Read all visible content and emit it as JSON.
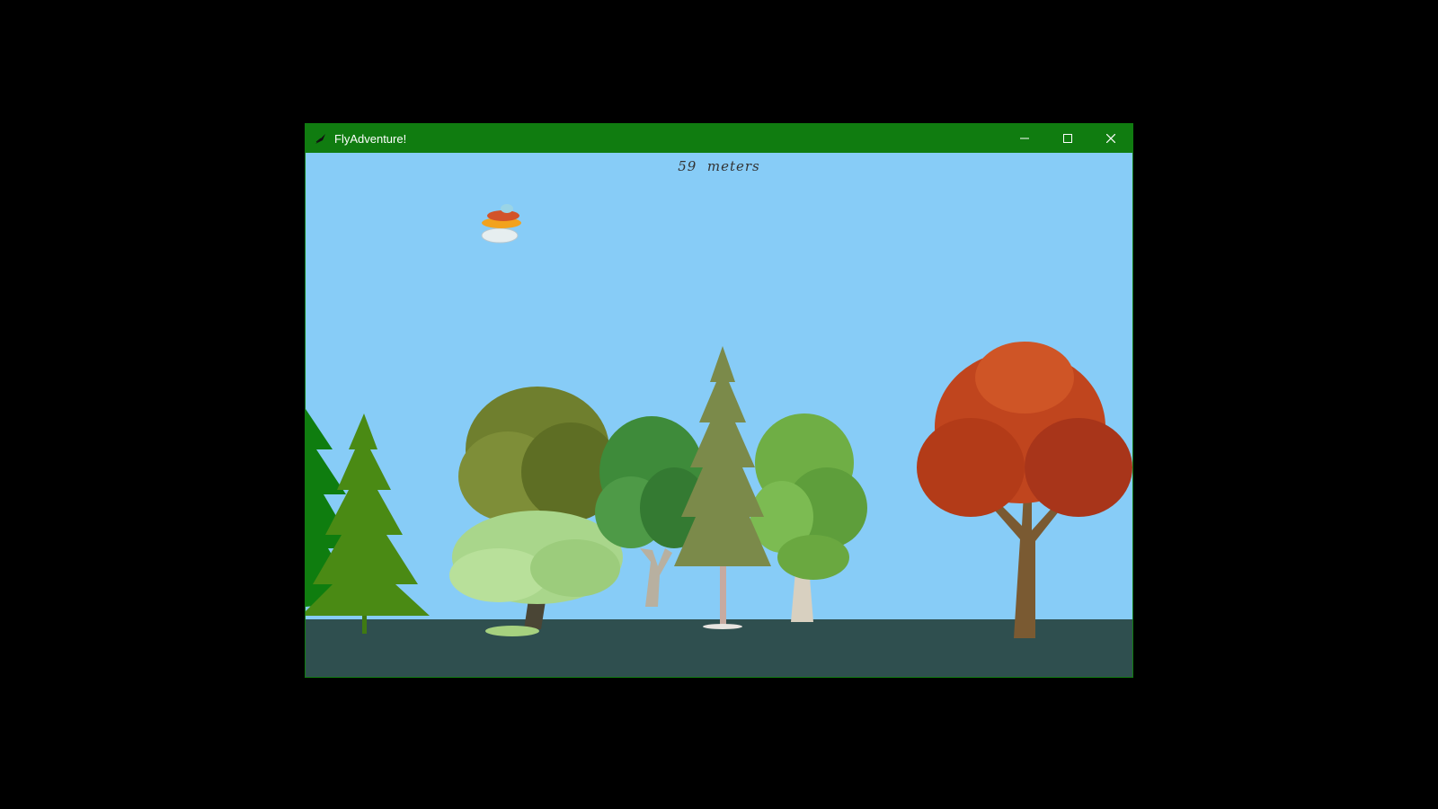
{
  "window": {
    "title": "FlyAdventure!",
    "icons": {
      "app": "feather-icon",
      "minimize": "minimize-icon",
      "maximize": "maximize-icon",
      "close": "close-icon"
    },
    "colors": {
      "titlebar": "#107c10",
      "sky": "#87ccf7",
      "ground": "#2f4f4f"
    }
  },
  "game": {
    "distance_value": "59",
    "distance_unit": "meters"
  }
}
